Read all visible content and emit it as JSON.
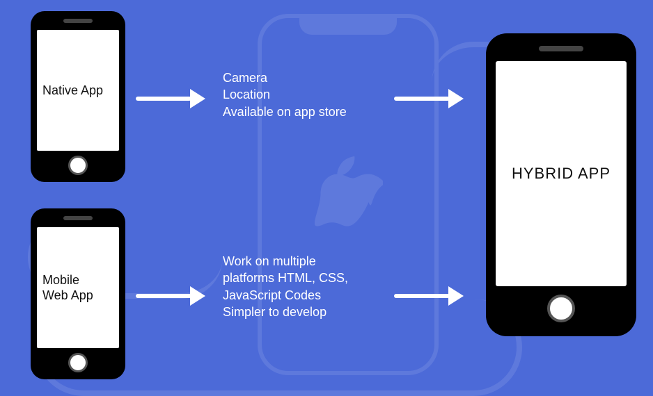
{
  "phones": {
    "native": {
      "label": "Native App"
    },
    "web": {
      "label": "Mobile\nWeb App"
    },
    "hybrid": {
      "label": "HYBRID APP"
    }
  },
  "features": {
    "native": {
      "line1": "Camera",
      "line2": "Location",
      "line3": "Available on app store"
    },
    "web": {
      "line1": "Work on multiple",
      "line2": "platforms HTML, CSS,",
      "line3": "JavaScript Codes",
      "line4": "Simpler to develop"
    }
  }
}
